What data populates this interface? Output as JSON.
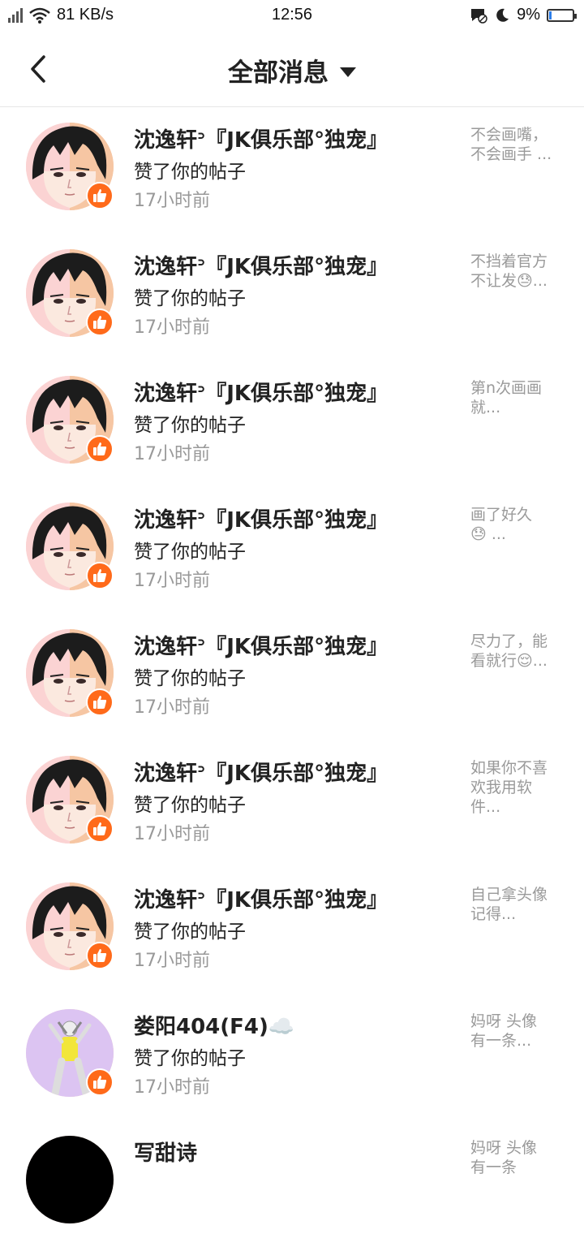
{
  "status_bar": {
    "network_speed": "81 KB/s",
    "time": "12:56",
    "battery_percent": "9%",
    "battery_level": 0.09
  },
  "header": {
    "title": "全部消息"
  },
  "colors": {
    "accent": "#ff6a1a",
    "secondary_text": "#999999"
  },
  "messages": [
    {
      "name": "沈逸轩ᐣ『JK俱乐部°独宠』",
      "action": "赞了你的帖子",
      "time": "17小时前",
      "snippet": "不会画嘴，\n不会画手 ...",
      "avatar": "anime-boy-avatar"
    },
    {
      "name": "沈逸轩ᐣ『JK俱乐部°独宠』",
      "action": "赞了你的帖子",
      "time": "17小时前",
      "snippet": "不挡着官方\n不让发😓...",
      "avatar": "anime-boy-avatar"
    },
    {
      "name": "沈逸轩ᐣ『JK俱乐部°独宠』",
      "action": "赞了你的帖子",
      "time": "17小时前",
      "snippet": "第n次画画\n就...",
      "avatar": "anime-boy-avatar"
    },
    {
      "name": "沈逸轩ᐣ『JK俱乐部°独宠』",
      "action": "赞了你的帖子",
      "time": "17小时前",
      "snippet": "画了好久\n😓 ...",
      "avatar": "anime-boy-avatar"
    },
    {
      "name": "沈逸轩ᐣ『JK俱乐部°独宠』",
      "action": "赞了你的帖子",
      "time": "17小时前",
      "snippet": "尽力了，能\n看就行😌...",
      "avatar": "anime-boy-avatar"
    },
    {
      "name": "沈逸轩ᐣ『JK俱乐部°独宠』",
      "action": "赞了你的帖子",
      "time": "17小时前",
      "snippet": "如果你不喜\n欢我用软\n件...",
      "avatar": "anime-boy-avatar"
    },
    {
      "name": "沈逸轩ᐣ『JK俱乐部°独宠』",
      "action": "赞了你的帖子",
      "time": "17小时前",
      "snippet": "自己拿头像\n记得...",
      "avatar": "anime-boy-avatar"
    },
    {
      "name": "娄阳404(F4)☁️",
      "action": "赞了你的帖子",
      "time": "17小时前",
      "snippet": "妈呀  头像\n有一条...",
      "avatar": "figure-avatar"
    },
    {
      "name": "写甜诗",
      "action": "",
      "time": "",
      "snippet": "妈呀  头像\n有一条",
      "avatar": "dark-avatar"
    }
  ]
}
